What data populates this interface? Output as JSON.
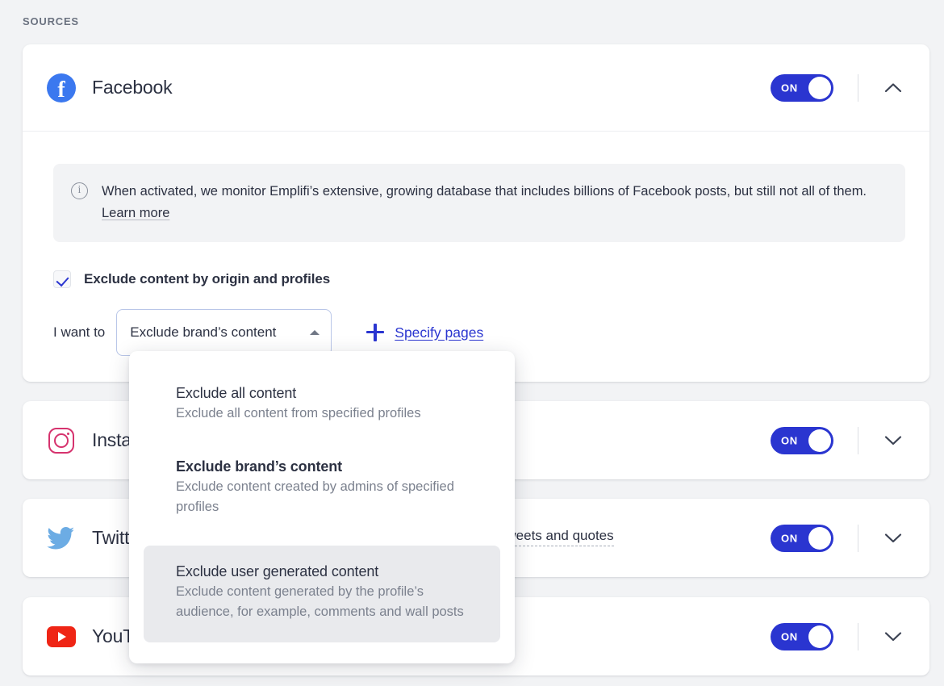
{
  "section": {
    "label": "SOURCES"
  },
  "colors": {
    "accent": "#2a35d0",
    "facebook": "#3b78ef",
    "instagram": "#d6336e",
    "twitter": "#6cace4",
    "youtube": "#ef2515",
    "page_bg": "#f2f3f5",
    "card_bg": "#ffffff",
    "text": "#2c3142",
    "muted": "#7b818e"
  },
  "cards": [
    {
      "id": "facebook",
      "name": "Facebook",
      "icon": "facebook-icon",
      "toggle_label": "ON",
      "toggle_on": true,
      "expanded": true,
      "chevron": "chevron-up-icon"
    },
    {
      "id": "instagram",
      "name": "Instagram",
      "icon": "instagram-icon",
      "toggle_label": "ON",
      "toggle_on": true,
      "expanded": false,
      "chevron": "chevron-down-icon"
    },
    {
      "id": "twitter",
      "name": "Twitter",
      "icon": "twitter-icon",
      "toggle_label": "ON",
      "toggle_on": true,
      "expanded": false,
      "chevron": "chevron-down-icon",
      "extra_option": "Include retweets and quotes"
    },
    {
      "id": "youtube",
      "name": "YouTube",
      "icon": "youtube-icon",
      "toggle_label": "ON",
      "toggle_on": true,
      "expanded": false,
      "chevron": "chevron-down-icon"
    }
  ],
  "facebook_body": {
    "info_icon": "info-circle-icon",
    "info_text": "When activated, we monitor Emplifi’s extensive, growing database that includes billions of Facebook posts, but still not all of them.",
    "info_link": "Learn more",
    "checkbox": {
      "label": "Exclude content by origin and profiles",
      "checked": true
    },
    "select_row": {
      "prefix_label": "I want to",
      "selected_value": "Exclude brand’s content",
      "caret": "caret-up-icon",
      "add_icon": "plus-icon",
      "add_label": "Specify pages"
    }
  },
  "dropdown": {
    "open": true,
    "options": [
      {
        "title": "Exclude all content",
        "description": "Exclude all content from specified profiles",
        "selected": false,
        "highlighted": false
      },
      {
        "title": "Exclude brand’s content",
        "description": "Exclude content created by admins of specified profiles",
        "selected": true,
        "highlighted": false
      },
      {
        "title": "Exclude user generated content",
        "description": "Exclude content generated by the profile’s audience, for example, comments and wall posts",
        "selected": false,
        "highlighted": true
      }
    ]
  }
}
